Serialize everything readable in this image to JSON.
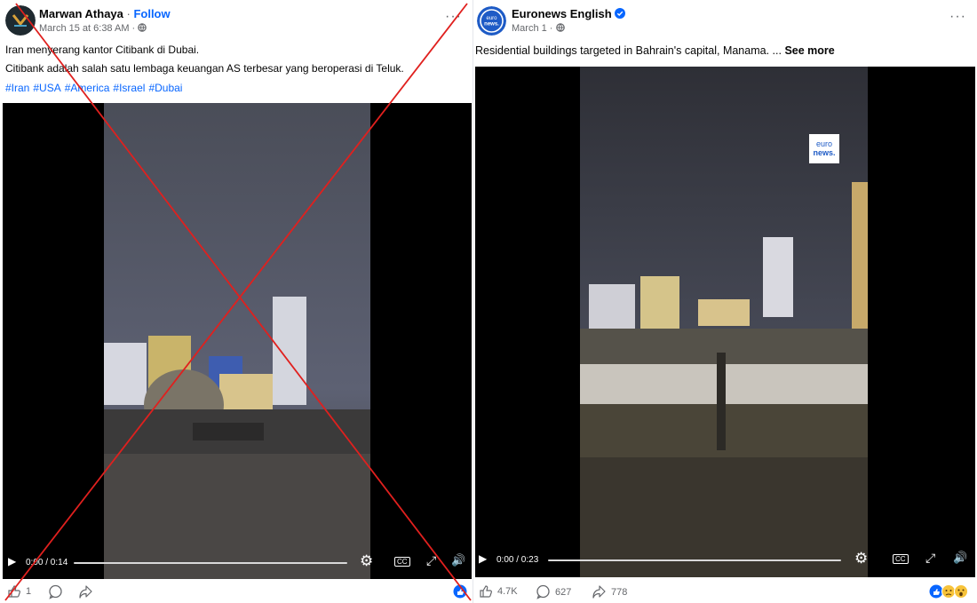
{
  "left_post": {
    "author": "Marwan Athaya",
    "follow_label": "Follow",
    "follow_sep": " · ",
    "meta": "March 15 at 6:38 AM · ",
    "caption_line1": "Iran menyerang kantor Citibank di Dubai.",
    "caption_line2": "Citibank adalah salah satu lembaga keuangan AS terbesar yang beroperasi di Teluk.",
    "hashtags": [
      "#Iran",
      "#USA",
      "#America",
      "#Israel",
      "#Dubai"
    ],
    "video_time": "0:00 / 0:14",
    "likes": "1",
    "more_label": "···",
    "mark_color": "#e0201e"
  },
  "right_post": {
    "author": "Euronews English",
    "meta": "March 1 · ",
    "caption": "Residential buildings targeted in Bahrain's capital, Manama. ...",
    "see_more": "See more",
    "video_time": "0:00 / 0:23",
    "likes": "4.7K",
    "comments": "627",
    "shares": "778",
    "more_label": "···",
    "logo_line1": "euro",
    "logo_line2": "news.",
    "avatar_line1": "euro",
    "avatar_line2": "news.",
    "brand_color": "#1e5bc6",
    "verified_color": "#0866ff"
  },
  "icons": {
    "play": "▶",
    "settings": "⚙",
    "cc": "CC",
    "fullscreen": "⤢",
    "volume": "🔊",
    "globe": "globe-icon",
    "like": "thumbs-up-icon",
    "comment": "comment-icon",
    "share": "share-icon"
  }
}
